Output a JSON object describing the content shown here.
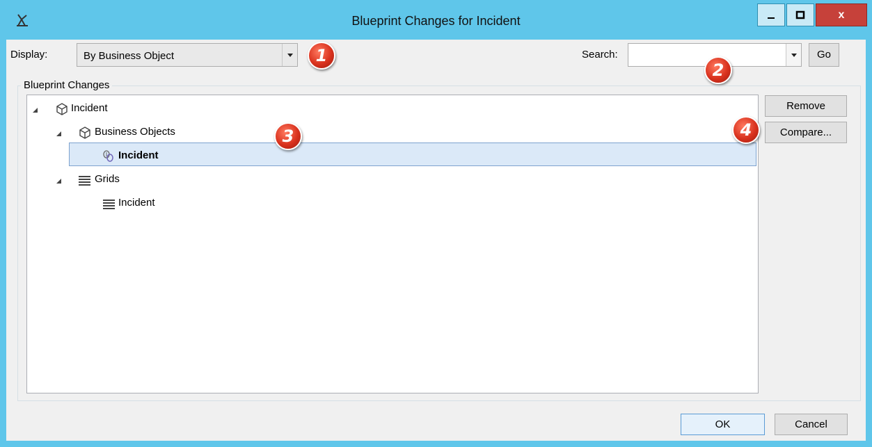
{
  "window": {
    "title": "Blueprint Changes for Incident",
    "close_glyph": "x",
    "accent": "#5fc6ea",
    "close_color": "#c6413a"
  },
  "toolbar": {
    "display_label": "Display:",
    "display_value": "By Business Object",
    "search_label": "Search:",
    "search_value": "",
    "go_label": "Go"
  },
  "group": {
    "title": "Blueprint Changes"
  },
  "tree": {
    "items": [
      {
        "label": "Incident",
        "level": 0,
        "icon": "cube-icon",
        "expanded": true
      },
      {
        "label": "Business Objects",
        "level": 1,
        "icon": "cube-icon",
        "expanded": true
      },
      {
        "label": "Incident",
        "level": 2,
        "icon": "business-object-link-icon",
        "selected": true,
        "bold": true
      },
      {
        "label": "Grids",
        "level": 1,
        "icon": "grid-icon",
        "expanded": true
      },
      {
        "label": "Incident",
        "level": 2,
        "icon": "grid-icon"
      }
    ]
  },
  "side_buttons": {
    "remove_label": "Remove",
    "compare_label": "Compare..."
  },
  "footer": {
    "ok_label": "OK",
    "cancel_label": "Cancel"
  },
  "callouts": [
    "1",
    "2",
    "3",
    "4"
  ]
}
